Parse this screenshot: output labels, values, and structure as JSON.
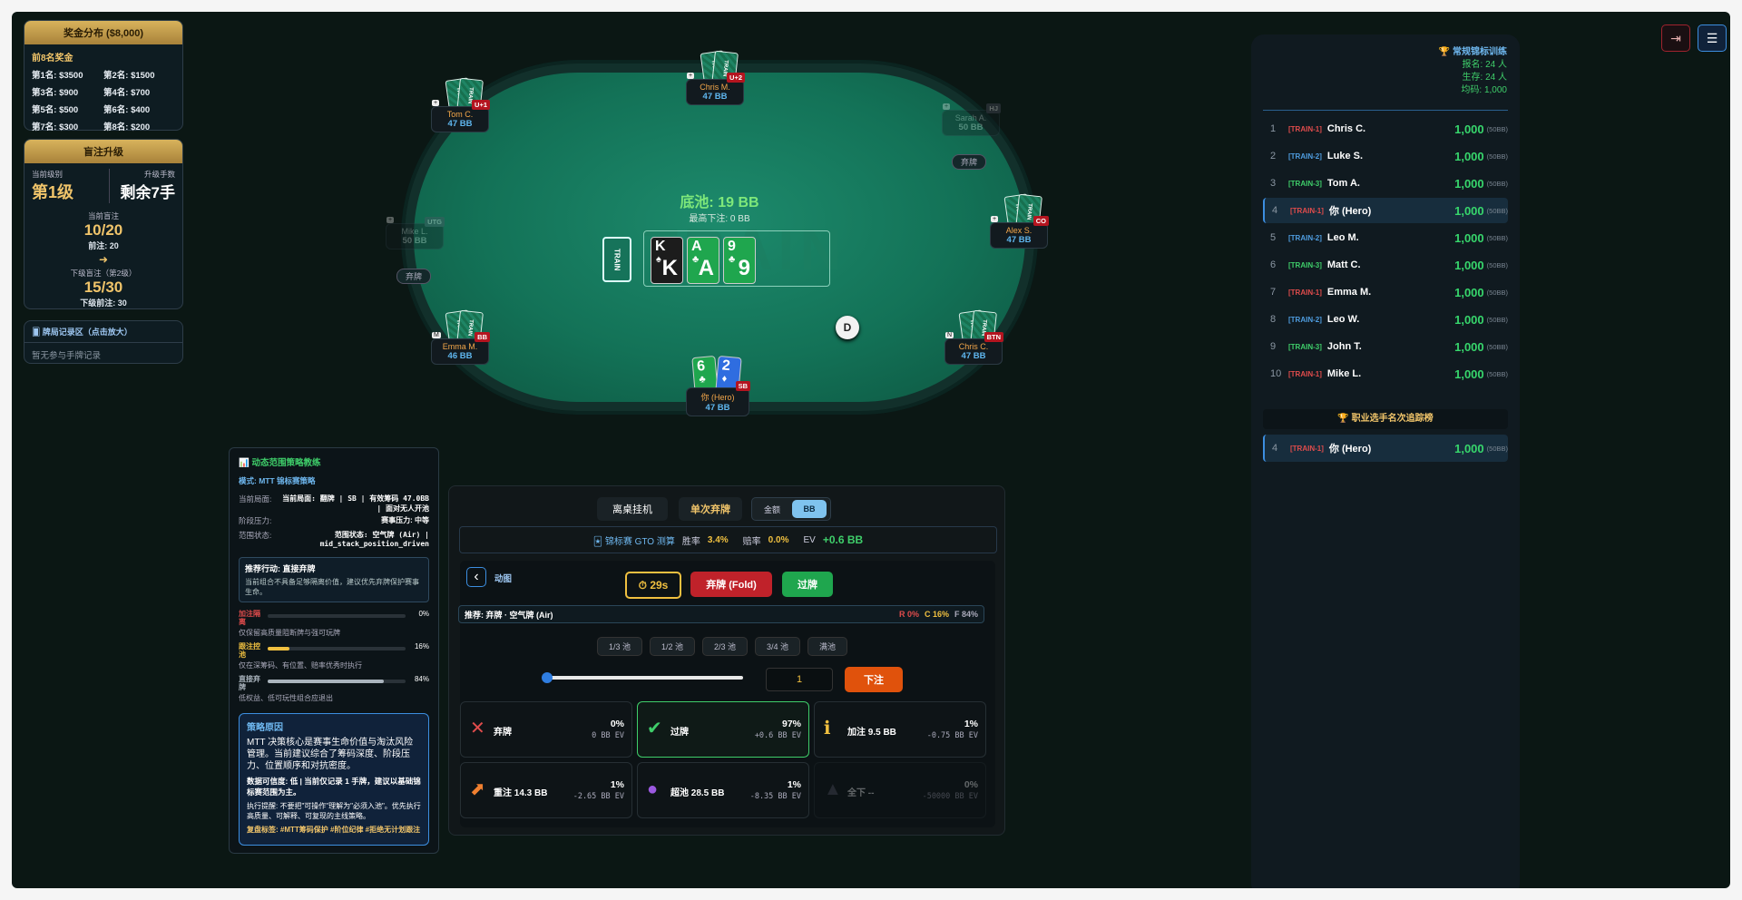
{
  "prize": {
    "title": "奖金分布 ($8,000)",
    "subtitle": "前8名奖金",
    "places": [
      "第1名: $3500",
      "第2名: $1500",
      "第3名: $900",
      "第4名: $700",
      "第5名: $500",
      "第6名: $400",
      "第7名: $300",
      "第8名: $200"
    ]
  },
  "blind": {
    "title": "盲注升级",
    "level_label": "当前级别",
    "level": "第1级",
    "hands_label": "升级手数",
    "hands": "剩余7手",
    "cur_label": "当前盲注",
    "cur": "10/20",
    "ante": "前注: 20",
    "arrow": "➜",
    "next_label": "下级盲注（第2级）",
    "next": "15/30",
    "next_ante": "下级前注: 30"
  },
  "history": {
    "title": "🂠 牌局记录区（点击放大）",
    "empty": "暂无参与手牌记录"
  },
  "table": {
    "pot": "底池: 19 BB",
    "max_bet": "最高下注: 0 BB",
    "train_label": "TRAIN",
    "watermark": "TRAIN",
    "dealer": "D",
    "card_back": "TRAIN",
    "fold": "弃牌",
    "seats": [
      {
        "name": "Chris M.",
        "stack": "47 BB",
        "pos": "U+2",
        "mark": "+"
      },
      {
        "name": "Tom C.",
        "stack": "47 BB",
        "pos": "U+1",
        "mark": "+"
      },
      {
        "name": "Sarah A.",
        "stack": "50 BB",
        "pos": "HJ",
        "mark": "+"
      },
      {
        "name": "Mike L.",
        "stack": "50 BB",
        "pos": "UTG",
        "mark": "+"
      },
      {
        "name": "Alex S.",
        "stack": "47 BB",
        "pos": "CO",
        "mark": "+"
      },
      {
        "name": "Emma M.",
        "stack": "46 BB",
        "pos": "BB",
        "mark": "M"
      },
      {
        "name": "Chris C.",
        "stack": "47 BB",
        "pos": "BTN",
        "mark": "N"
      },
      {
        "name": "你 (Hero)",
        "stack": "47 BB",
        "pos": "SB",
        "mark": ""
      }
    ],
    "board": [
      {
        "rank": "K",
        "suit": "♠"
      },
      {
        "rank": "A",
        "suit": "♣"
      },
      {
        "rank": "9",
        "suit": "♣"
      }
    ],
    "hero_cards": [
      {
        "rank": "6",
        "suit": "♣"
      },
      {
        "rank": "2",
        "suit": "♦"
      }
    ]
  },
  "leaderboard": {
    "title": "🏆 常规锦标训练",
    "registered": "报名: 24 人",
    "alive": "生存: 24 人",
    "avg": "均码: 1,000",
    "pro_title": "🏆 职业选手名次追踪榜",
    "rows": [
      {
        "rank": "1",
        "tag": "[TRAIN-1]",
        "name": "Chris C.",
        "chips": "1,000",
        "bb": "(50BB)",
        "color": "#e04c4c"
      },
      {
        "rank": "2",
        "tag": "[TRAIN-2]",
        "name": "Luke S.",
        "chips": "1,000",
        "bb": "(50BB)",
        "color": "#4f9de0"
      },
      {
        "rank": "3",
        "tag": "[TRAIN-3]",
        "name": "Tom A.",
        "chips": "1,000",
        "bb": "(50BB)",
        "color": "#3fce6a"
      },
      {
        "rank": "4",
        "tag": "[TRAIN-1]",
        "name": "你 (Hero)",
        "chips": "1,000",
        "bb": "(50BB)",
        "color": "#e04c4c"
      },
      {
        "rank": "5",
        "tag": "[TRAIN-2]",
        "name": "Leo M.",
        "chips": "1,000",
        "bb": "(50BB)",
        "color": "#4f9de0"
      },
      {
        "rank": "6",
        "tag": "[TRAIN-3]",
        "name": "Matt C.",
        "chips": "1,000",
        "bb": "(50BB)",
        "color": "#3fce6a"
      },
      {
        "rank": "7",
        "tag": "[TRAIN-1]",
        "name": "Emma M.",
        "chips": "1,000",
        "bb": "(50BB)",
        "color": "#e04c4c"
      },
      {
        "rank": "8",
        "tag": "[TRAIN-2]",
        "name": "Leo W.",
        "chips": "1,000",
        "bb": "(50BB)",
        "color": "#4f9de0"
      },
      {
        "rank": "9",
        "tag": "[TRAIN-3]",
        "name": "John T.",
        "chips": "1,000",
        "bb": "(50BB)",
        "color": "#3fce6a"
      },
      {
        "rank": "10",
        "tag": "[TRAIN-1]",
        "name": "Mike L.",
        "chips": "1,000",
        "bb": "(50BB)",
        "color": "#e04c4c"
      }
    ],
    "pro_row": {
      "rank": "4",
      "tag": "[TRAIN-1]",
      "name": "你 (Hero)",
      "chips": "1,000",
      "bb": "(50BB)"
    }
  },
  "coach": {
    "title": "📊 动态范围策略教练",
    "mode": "模式: MTT 锦标赛策略",
    "scene_label": "当前局面:",
    "scene": "当前局面: 翻牌 | SB | 有效筹码 47.0BB | 面对无人开池",
    "pressure_label": "阶段压力:",
    "pressure": "赛事压力: 中等",
    "range_label": "范围状态:",
    "range": "范围状态: 空气牌 (Air) | mid_stack_position_driven",
    "rec_title": "推荐行动: 直接弃牌",
    "rec_text": "当前组合不具备足够隔离价值，建议优先弃牌保护赛事生命。",
    "bars": [
      {
        "label": "加注隔离",
        "pct": "0%",
        "val": 0,
        "desc": "仅保留高质量阻断牌与强可玩牌",
        "color": "#e04c4c"
      },
      {
        "label": "跟注控池",
        "pct": "16%",
        "val": 16,
        "desc": "仅在深筹码、有位置、赔率优秀时执行",
        "color": "#f0c040"
      },
      {
        "label": "直接弃牌",
        "pct": "84%",
        "val": 84,
        "desc": "低权益、低可玩性组合应退出",
        "color": "#aab4bd"
      }
    ],
    "reason_title": "策略原因",
    "reason_main": "MTT 决策核心是赛事生命价值与淘汰风险管理。当前建议综合了筹码深度、阶段压力、位置顺序和对抗密度。",
    "reason_conf": "数据可信度: 低 | 当前仅记录 1 手牌，建议以基础锦标赛范围为主。",
    "reason_exec": "执行提醒: 不要把\"可操作\"理解为\"必须入池\"。优先执行高质量、可解释、可复现的主线策略。",
    "tags": "复盘标签: #MTT筹码保护 #阶位纪律 #拒绝无计划跟注"
  },
  "action": {
    "leave": "离桌挂机",
    "fold_once": "单次弃牌",
    "toggle_chips": "金额",
    "toggle_bb": "BB",
    "gto_label": "🃏 锦标赛 GTO 测算",
    "win_label": "胜率",
    "win": "3.4%",
    "lose_label": "赔率",
    "lose": "0.0%",
    "ev_label": "EV",
    "ev": "+0.6 BB",
    "back": "‹",
    "street": "动图",
    "timer": "⏱ 29s",
    "fold": "弃牌 (Fold)",
    "check": "过牌",
    "rec": "推荐: 弃牌 · 空气牌 (Air)",
    "r_pct": "R 0%",
    "c_pct": "C 16%",
    "f_pct": "F 84%",
    "sizes": [
      "1/3 池",
      "1/2 池",
      "2/3 池",
      "3/4 池",
      "满池"
    ],
    "amount": "1",
    "bet": "下注",
    "slider_value": 0,
    "options": [
      {
        "label": "弃牌",
        "pct": "0%",
        "ev": "0 BB EV",
        "icon": "✕",
        "color": "#e04c4c"
      },
      {
        "label": "过牌",
        "pct": "97%",
        "ev": "+0.6 BB EV",
        "icon": "✔",
        "color": "#3fce6a"
      },
      {
        "label": "加注 9.5 BB",
        "pct": "1%",
        "ev": "-0.75 BB EV",
        "icon": "ℹ",
        "color": "#f0c040"
      },
      {
        "label": "重注 14.3 BB",
        "pct": "1%",
        "ev": "-2.65 BB EV",
        "icon": "⬈",
        "color": "#f08030"
      },
      {
        "label": "超池 28.5 BB",
        "pct": "1%",
        "ev": "-8.35 BB EV",
        "icon": "●",
        "color": "#9b59e0"
      },
      {
        "label": "全下 --",
        "pct": "0%",
        "ev": "-50000 BB EV",
        "icon": "▲",
        "color": "#556"
      }
    ]
  },
  "topright": {
    "exit_icon": "⇥",
    "menu_icon": "☰"
  }
}
